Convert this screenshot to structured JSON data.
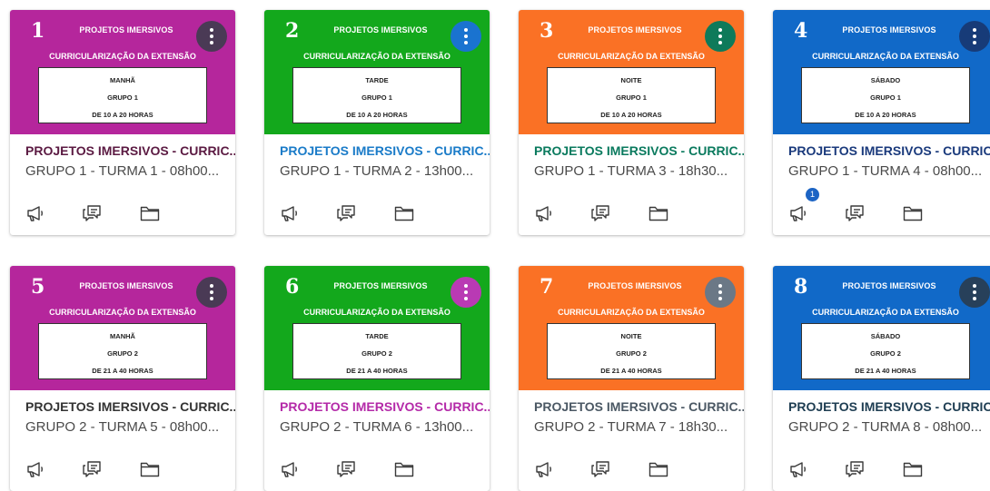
{
  "cards": [
    {
      "number": "1",
      "project": "PROJETOS IMERSIVOS",
      "subtitle": "CURRICULARIZAÇÃO DA EXTENSÃO",
      "period": "MANHÃ",
      "group": "GRUPO 1",
      "hours": "DE 10 A 20 HORAS",
      "title": "PROJETOS IMERSIVOS - CURRIC...",
      "term": "GRUPO 1 - TURMA 1 - 08h00...",
      "color": "#b5269c",
      "menu_color": "#4a3a55",
      "title_color": "#5b1a42",
      "badge": null
    },
    {
      "number": "2",
      "project": "PROJETOS IMERSIVOS",
      "subtitle": "CURRICULARIZAÇÃO DA EXTENSÃO",
      "period": "TARDE",
      "group": "GRUPO 1",
      "hours": "DE 10 A 20 HORAS",
      "title": "PROJETOS IMERSIVOS - CURRIC...",
      "term": "GRUPO 1 - TURMA 2 - 13h00...",
      "color": "#13a81c",
      "menu_color": "#1a73d0",
      "title_color": "#1a7bc8",
      "badge": null
    },
    {
      "number": "3",
      "project": "PROJETOS IMERSIVOS",
      "subtitle": "CURRICULARIZAÇÃO DA EXTENSÃO",
      "period": "NOITE",
      "group": "GRUPO 1",
      "hours": "DE 10 A 20 HORAS",
      "title": "PROJETOS IMERSIVOS - CURRIC...",
      "term": "GRUPO 1 - TURMA 3 - 18h30...",
      "color": "#fa7125",
      "menu_color": "#0e7a5a",
      "title_color": "#0a7a5e",
      "badge": null
    },
    {
      "number": "4",
      "project": "PROJETOS IMERSIVOS",
      "subtitle": "CURRICULARIZAÇÃO DA EXTENSÃO",
      "period": "SÁBADO",
      "group": "GRUPO 1",
      "hours": "DE 10 A 20 HORAS",
      "title": "PROJETOS IMERSIVOS - CURRIC...",
      "term": "GRUPO 1 - TURMA 4 - 08h00...",
      "color": "#1169c8",
      "menu_color": "#173b78",
      "title_color": "#1a3a7c",
      "badge": "1"
    },
    {
      "number": "5",
      "project": "PROJETOS IMERSIVOS",
      "subtitle": "CURRICULARIZAÇÃO DA EXTENSÃO",
      "period": "MANHÃ",
      "group": "GRUPO 2",
      "hours": "DE 21 A 40 HORAS",
      "title": "PROJETOS IMERSIVOS - CURRIC...",
      "term": "GRUPO 2 - TURMA 5 - 08h00...",
      "color": "#b5269c",
      "menu_color": "#4a3a55",
      "title_color": "#333333",
      "badge": null
    },
    {
      "number": "6",
      "project": "PROJETOS IMERSIVOS",
      "subtitle": "CURRICULARIZAÇÃO DA EXTENSÃO",
      "period": "TARDE",
      "group": "GRUPO 2",
      "hours": "DE 21 A 40 HORAS",
      "title": "PROJETOS IMERSIVOS - CURRIC...",
      "term": "GRUPO 2 - TURMA 6 - 13h00...",
      "color": "#13a81c",
      "menu_color": "#b93ab4",
      "title_color": "#b42aa8",
      "badge": null
    },
    {
      "number": "7",
      "project": "PROJETOS IMERSIVOS",
      "subtitle": "CURRICULARIZAÇÃO DA EXTENSÃO",
      "period": "NOITE",
      "group": "GRUPO 2",
      "hours": "DE 21 A 40 HORAS",
      "title": "PROJETOS IMERSIVOS - CURRIC...",
      "term": "GRUPO 2 - TURMA 7 - 18h30...",
      "color": "#fa7125",
      "menu_color": "#6b7886",
      "title_color": "#4b5864",
      "badge": null
    },
    {
      "number": "8",
      "project": "PROJETOS IMERSIVOS",
      "subtitle": "CURRICULARIZAÇÃO DA EXTENSÃO",
      "period": "SÁBADO",
      "group": "GRUPO 2",
      "hours": "DE 21 A 40 HORAS",
      "title": "PROJETOS IMERSIVOS - CURRIC...",
      "term": "GRUPO 2 - TURMA 8 - 08h00...",
      "color": "#1169c8",
      "menu_color": "#27405a",
      "title_color": "#1e3d52",
      "badge": null
    }
  ],
  "icons": {
    "announcements": "megaphone-icon",
    "discussions": "discussion-icon",
    "files": "folder-icon"
  }
}
